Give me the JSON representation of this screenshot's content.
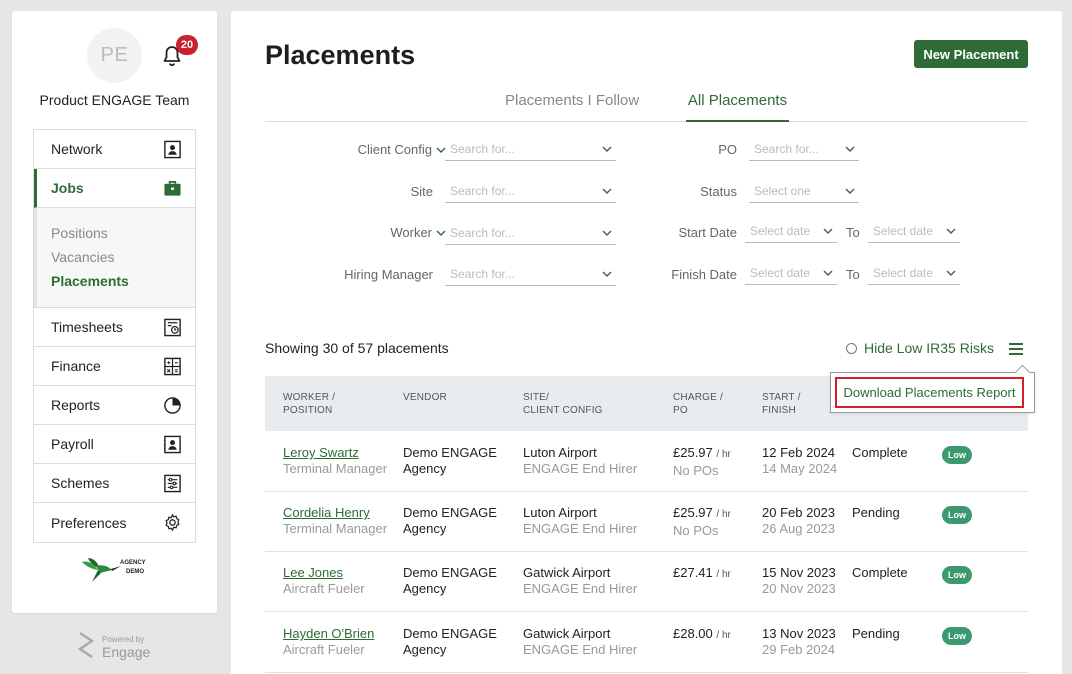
{
  "sidebar": {
    "avatar_initials": "PE",
    "notification_count": "20",
    "team_name": "Product ENGAGE Team",
    "nav": {
      "network": "Network",
      "jobs": "Jobs",
      "sub_positions": "Positions",
      "sub_vacancies": "Vacancies",
      "sub_placements": "Placements",
      "timesheets": "Timesheets",
      "finance": "Finance",
      "reports": "Reports",
      "payroll": "Payroll",
      "schemes": "Schemes",
      "preferences": "Preferences"
    },
    "agency_logo_line1": "AGENCY",
    "agency_logo_line2": "DEMO",
    "powered_by": "Powered by",
    "powered_brand": "Engage"
  },
  "header": {
    "title": "Placements",
    "new_button": "New Placement"
  },
  "tabs": {
    "follow": "Placements I Follow",
    "all": "All Placements"
  },
  "filters": {
    "client_config": "Client Config",
    "site": "Site",
    "worker": "Worker",
    "hiring_manager": "Hiring Manager",
    "po": "PO",
    "status": "Status",
    "start_date": "Start Date",
    "finish_date": "Finish Date",
    "to": "To",
    "search_placeholder": "Search for...",
    "select_one": "Select one",
    "select_date": "Select date"
  },
  "list": {
    "showing": "Showing 30 of 57 placements",
    "hide_low_risk": "Hide Low IR35 Risks",
    "download_report": "Download Placements Report"
  },
  "columns": {
    "worker": "WORKER /",
    "position": "POSITION",
    "vendor": "VENDOR",
    "site": "SITE/",
    "client_config": "CLIENT CONFIG",
    "charge": "CHARGE /",
    "po": "PO",
    "start": "START /",
    "finish": "FINISH"
  },
  "rows": [
    {
      "worker": "Leroy Swartz",
      "position": "Terminal Manager",
      "vendor1": "Demo ENGAGE",
      "vendor2": "Agency",
      "site": "Luton Airport",
      "config": "ENGAGE End Hirer",
      "charge": "£25.97",
      "unit": "/ hr",
      "po": "No POs",
      "start": "12 Feb 2024",
      "finish": "14 May 2024",
      "status": "Complete",
      "risk": "Low"
    },
    {
      "worker": "Cordelia Henry",
      "position": "Terminal Manager",
      "vendor1": "Demo ENGAGE",
      "vendor2": "Agency",
      "site": "Luton Airport",
      "config": "ENGAGE End Hirer",
      "charge": "£25.97",
      "unit": "/ hr",
      "po": "No POs",
      "start": "20 Feb 2023",
      "finish": "26 Aug 2023",
      "status": "Pending",
      "risk": "Low"
    },
    {
      "worker": "Lee Jones",
      "position": "Aircraft Fueler",
      "vendor1": "Demo ENGAGE",
      "vendor2": "Agency",
      "site": "Gatwick Airport",
      "config": "ENGAGE End Hirer",
      "charge": "£27.41",
      "unit": "/ hr",
      "po": "",
      "start": "15 Nov 2023",
      "finish": "20 Nov 2023",
      "status": "Complete",
      "risk": "Low"
    },
    {
      "worker": "Hayden O'Brien",
      "position": "Aircraft Fueler",
      "vendor1": "Demo ENGAGE",
      "vendor2": "Agency",
      "site": "Gatwick Airport",
      "config": "ENGAGE End Hirer",
      "charge": "£28.00",
      "unit": "/ hr",
      "po": "",
      "start": "13 Nov 2023",
      "finish": "29 Feb 2024",
      "status": "Pending",
      "risk": "Low"
    }
  ],
  "colors": {
    "brand": "#2e6b36",
    "badge": "#c8232c",
    "pill": "#3d9970",
    "highlight": "#d0202a"
  }
}
